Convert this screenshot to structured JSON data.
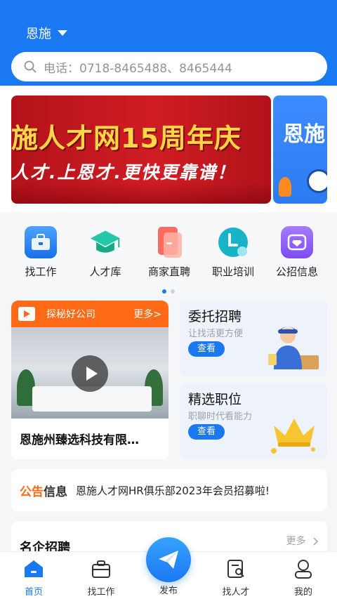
{
  "header": {
    "city": "恩施",
    "search_placeholder": "电话：0718-8465488、8465444"
  },
  "banner": {
    "main_title": "施人才网15周年庆",
    "main_subtitle": "人才.上恩才.更快更靠谱！",
    "side_title": "恩施"
  },
  "quick_links": [
    {
      "label": "找工作",
      "icon": "briefcase-icon",
      "color": "#2f88ff"
    },
    {
      "label": "人才库",
      "icon": "graduation-cap-icon",
      "color": "#1fbf9f"
    },
    {
      "label": "商家直聘",
      "icon": "phone-card-icon",
      "color": "#ff6a5a"
    },
    {
      "label": "职业培训",
      "icon": "training-clock-icon",
      "color": "#1cb6c9"
    },
    {
      "label": "公招信息",
      "icon": "diamond-envelope-icon",
      "color": "#8a5cf6"
    }
  ],
  "video_card": {
    "title": "探秘好公司",
    "more": "更多>",
    "caption": "恩施州臻选科技有限…"
  },
  "promo_cards": [
    {
      "title": "委托招聘",
      "subtitle": "让找活更方便",
      "button": "查看"
    },
    {
      "title": "精选职位",
      "subtitle": "职聊时代看能力",
      "button": "查看"
    }
  ],
  "notice": {
    "tag_part1": "公告",
    "tag_part2": "信息",
    "text": "恩施人才网HR俱乐部2023年会员招募啦!"
  },
  "famous": {
    "title": "名企招聘",
    "more": "更多"
  },
  "tabbar": {
    "home": "首页",
    "find_job": "找工作",
    "publish": "发布",
    "find_talent": "找人才",
    "mine": "我的"
  },
  "colors": {
    "primary": "#1a78f2",
    "accent_orange": "#ff6a17"
  }
}
